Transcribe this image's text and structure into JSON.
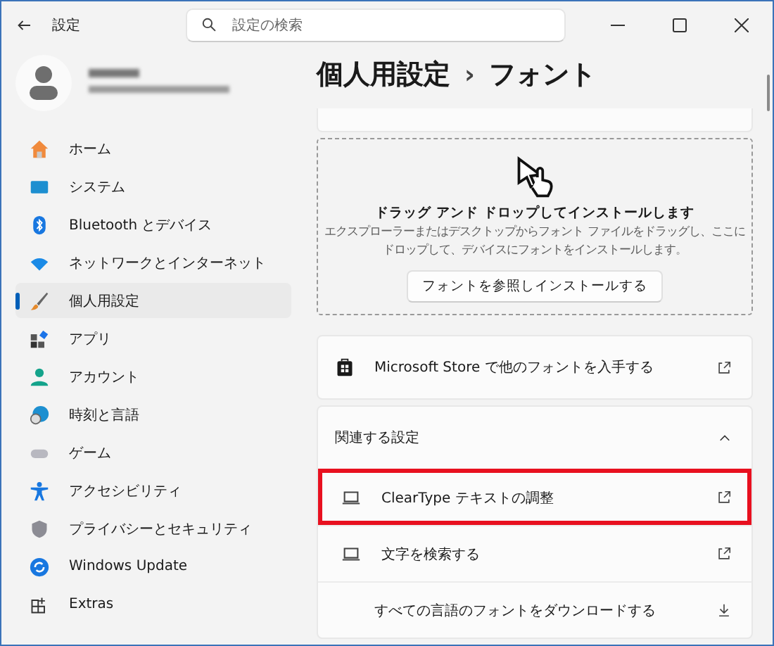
{
  "window": {
    "title": "設定"
  },
  "search": {
    "placeholder": "設定の検索"
  },
  "sidebar": {
    "items": [
      {
        "label": "ホーム",
        "selected": false
      },
      {
        "label": "システム",
        "selected": false
      },
      {
        "label": "Bluetooth とデバイス",
        "selected": false
      },
      {
        "label": "ネットワークとインターネット",
        "selected": false
      },
      {
        "label": "個人用設定",
        "selected": true
      },
      {
        "label": "アプリ",
        "selected": false
      },
      {
        "label": "アカウント",
        "selected": false
      },
      {
        "label": "時刻と言語",
        "selected": false
      },
      {
        "label": "ゲーム",
        "selected": false
      },
      {
        "label": "アクセシビリティ",
        "selected": false
      },
      {
        "label": "プライバシーとセキュリティ",
        "selected": false
      },
      {
        "label": "Windows Update",
        "selected": false
      },
      {
        "label": "Extras",
        "selected": false
      }
    ]
  },
  "breadcrumb": [
    "個人用設定",
    "›",
    "フォント"
  ],
  "dropzone": {
    "title": "ドラッグ アンド ドロップしてインストールします",
    "description": "エクスプローラーまたはデスクトップからフォント ファイルをドラッグし、ここにドロップして、デバイスにフォントをインストールします。",
    "button": "フォントを参照しインストールする"
  },
  "store_link": "Microsoft Store で他のフォントを入手する",
  "related": {
    "title": "関連する設定",
    "expanded": true,
    "rows": [
      {
        "label": "ClearType テキストの調整",
        "kind": "link",
        "highlighted": true
      },
      {
        "label": "文字を検索する",
        "kind": "link",
        "highlighted": false
      },
      {
        "label": "すべての言語のフォントをダウンロードする",
        "kind": "download",
        "highlighted": false
      }
    ]
  }
}
